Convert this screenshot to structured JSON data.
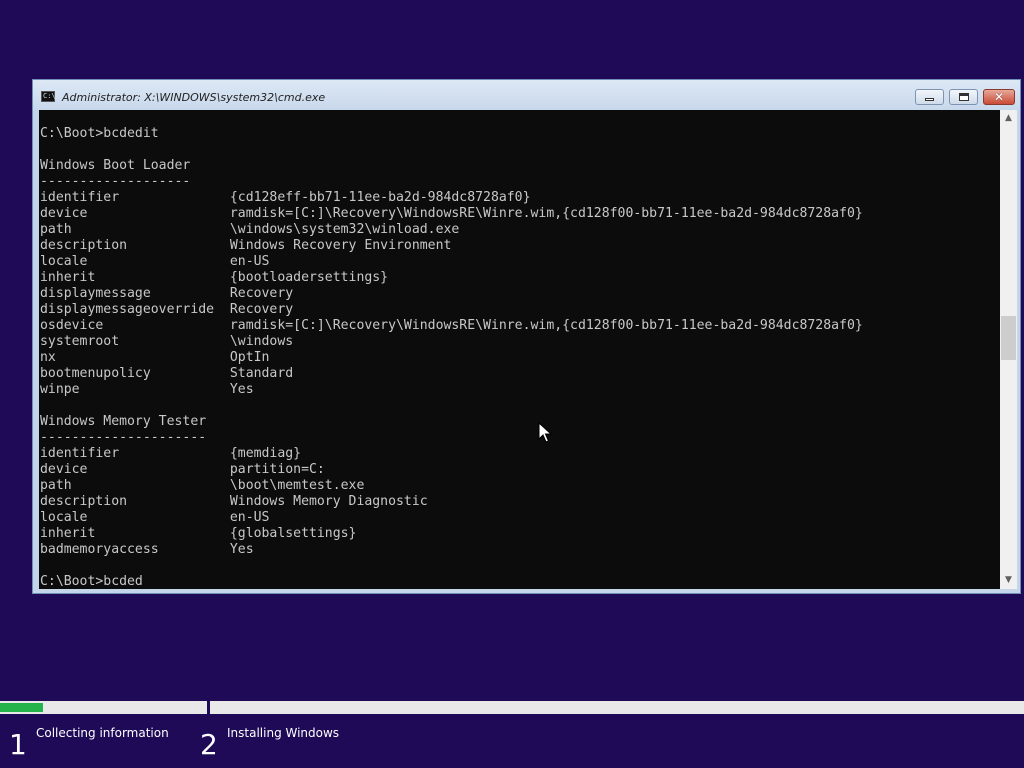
{
  "window": {
    "title": "Administrator: X:\\WINDOWS\\system32\\cmd.exe",
    "icon": "console-app-icon",
    "controls": {
      "minimize_icon": "minimize-icon",
      "maximize_icon": "maximize-icon",
      "close_glyph": "✕"
    }
  },
  "console": {
    "lines": [
      "C:\\Boot>bcdedit",
      "",
      "Windows Boot Loader",
      "-------------------",
      "identifier              {cd128eff-bb71-11ee-ba2d-984dc8728af0}",
      "device                  ramdisk=[C:]\\Recovery\\WindowsRE\\Winre.wim,{cd128f00-bb71-11ee-ba2d-984dc8728af0}",
      "path                    \\windows\\system32\\winload.exe",
      "description             Windows Recovery Environment",
      "locale                  en-US",
      "inherit                 {bootloadersettings}",
      "displaymessage          Recovery",
      "displaymessageoverride  Recovery",
      "osdevice                ramdisk=[C:]\\Recovery\\WindowsRE\\Winre.wim,{cd128f00-bb71-11ee-ba2d-984dc8728af0}",
      "systemroot              \\windows",
      "nx                      OptIn",
      "bootmenupolicy          Standard",
      "winpe                   Yes",
      "",
      "Windows Memory Tester",
      "---------------------",
      "identifier              {memdiag}",
      "device                  partition=C:",
      "path                    \\boot\\memtest.exe",
      "description             Windows Memory Diagnostic",
      "locale                  en-US",
      "inherit                 {globalsettings}",
      "badmemoryaccess         Yes",
      "",
      "C:\\Boot>bcded"
    ]
  },
  "scrollbar": {
    "up_glyph": "▲",
    "down_glyph": "▼"
  },
  "setup": {
    "progress_fraction": 0.21,
    "steps": [
      {
        "number": "1",
        "label": "Collecting information"
      },
      {
        "number": "2",
        "label": "Installing Windows"
      }
    ]
  },
  "colors": {
    "background": "#1e0a57",
    "console_bg": "#0c0c0c",
    "console_text": "#c8c8c8",
    "progress_fill": "#24b24a"
  }
}
